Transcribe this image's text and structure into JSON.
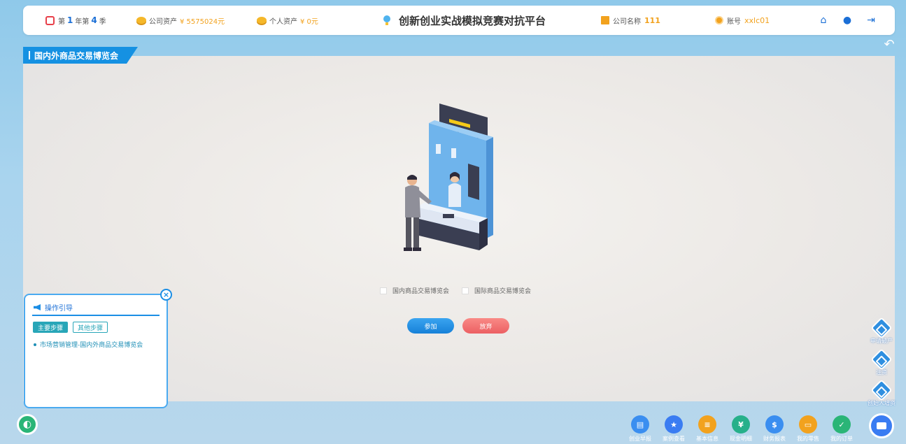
{
  "topbar": {
    "round_prefix": "第",
    "year": "1",
    "year_unit": "年第",
    "season": "4",
    "season_unit": "季",
    "company_assets_label": "公司资产",
    "company_assets_value": "¥ 5575024元",
    "personal_assets_label": "个人资产",
    "personal_assets_value": "¥ 0元",
    "platform_title": "创新创业实战模拟竞赛对抗平台",
    "company_name_label": "公司名称",
    "company_name_value": "111",
    "account_label": "账号",
    "account_value": "xxlc01"
  },
  "breadcrumb": "国内外商品交易博览会",
  "options": [
    "国内商品交易博览会",
    "国际商品交易博览会"
  ],
  "buttons": {
    "join": "参加",
    "quit": "放弃"
  },
  "guide": {
    "title": "操作引导",
    "tab_main": "主要步骤",
    "tab_other": "其他步骤",
    "item": "市场营销管理-国内外商品交易博览会"
  },
  "side_buttons": [
    "申请破产",
    "注资",
    "创始人增资"
  ],
  "bottom_nav": [
    {
      "label": "创业早报",
      "color": "#3a8ef0",
      "glyph": "▤"
    },
    {
      "label": "案例查看",
      "color": "#3a7cf2",
      "glyph": "★"
    },
    {
      "label": "基本信息",
      "color": "#f2a21e",
      "glyph": "≡"
    },
    {
      "label": "现金明细",
      "color": "#26b08a",
      "glyph": "¥"
    },
    {
      "label": "财务报表",
      "color": "#3a8ef0",
      "glyph": "$"
    },
    {
      "label": "我的零售",
      "color": "#f2a21e",
      "glyph": "▭"
    },
    {
      "label": "我的订单",
      "color": "#2ab577",
      "glyph": "✓"
    }
  ],
  "colors": {
    "accent": "#1591e2",
    "join": "#1781d8",
    "quit": "#ec5f63"
  }
}
